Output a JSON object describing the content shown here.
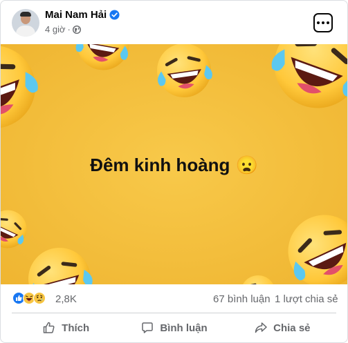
{
  "post": {
    "author_name": "Mai Nam Hải",
    "time": "4 giờ",
    "separator": "·",
    "caption": "Đêm kinh hoàng",
    "caption_emoji": "😦",
    "reaction_count": "2,8K",
    "comments": "67 bình luận",
    "shares": "1 lượt chia sẻ",
    "actions": {
      "like": "Thích",
      "comment": "Bình luận",
      "share": "Chia sẻ"
    }
  },
  "icons": {
    "verified": "verified-badge-icon",
    "audience": "globe-icon",
    "more": "more-options-icon",
    "reactions": [
      "like-reaction-icon",
      "haha-reaction-icon",
      "sad-reaction-icon"
    ]
  },
  "colors": {
    "background_yellow": "#f5c23e",
    "verified_blue": "#1877f2",
    "muted_text": "#65676b"
  }
}
